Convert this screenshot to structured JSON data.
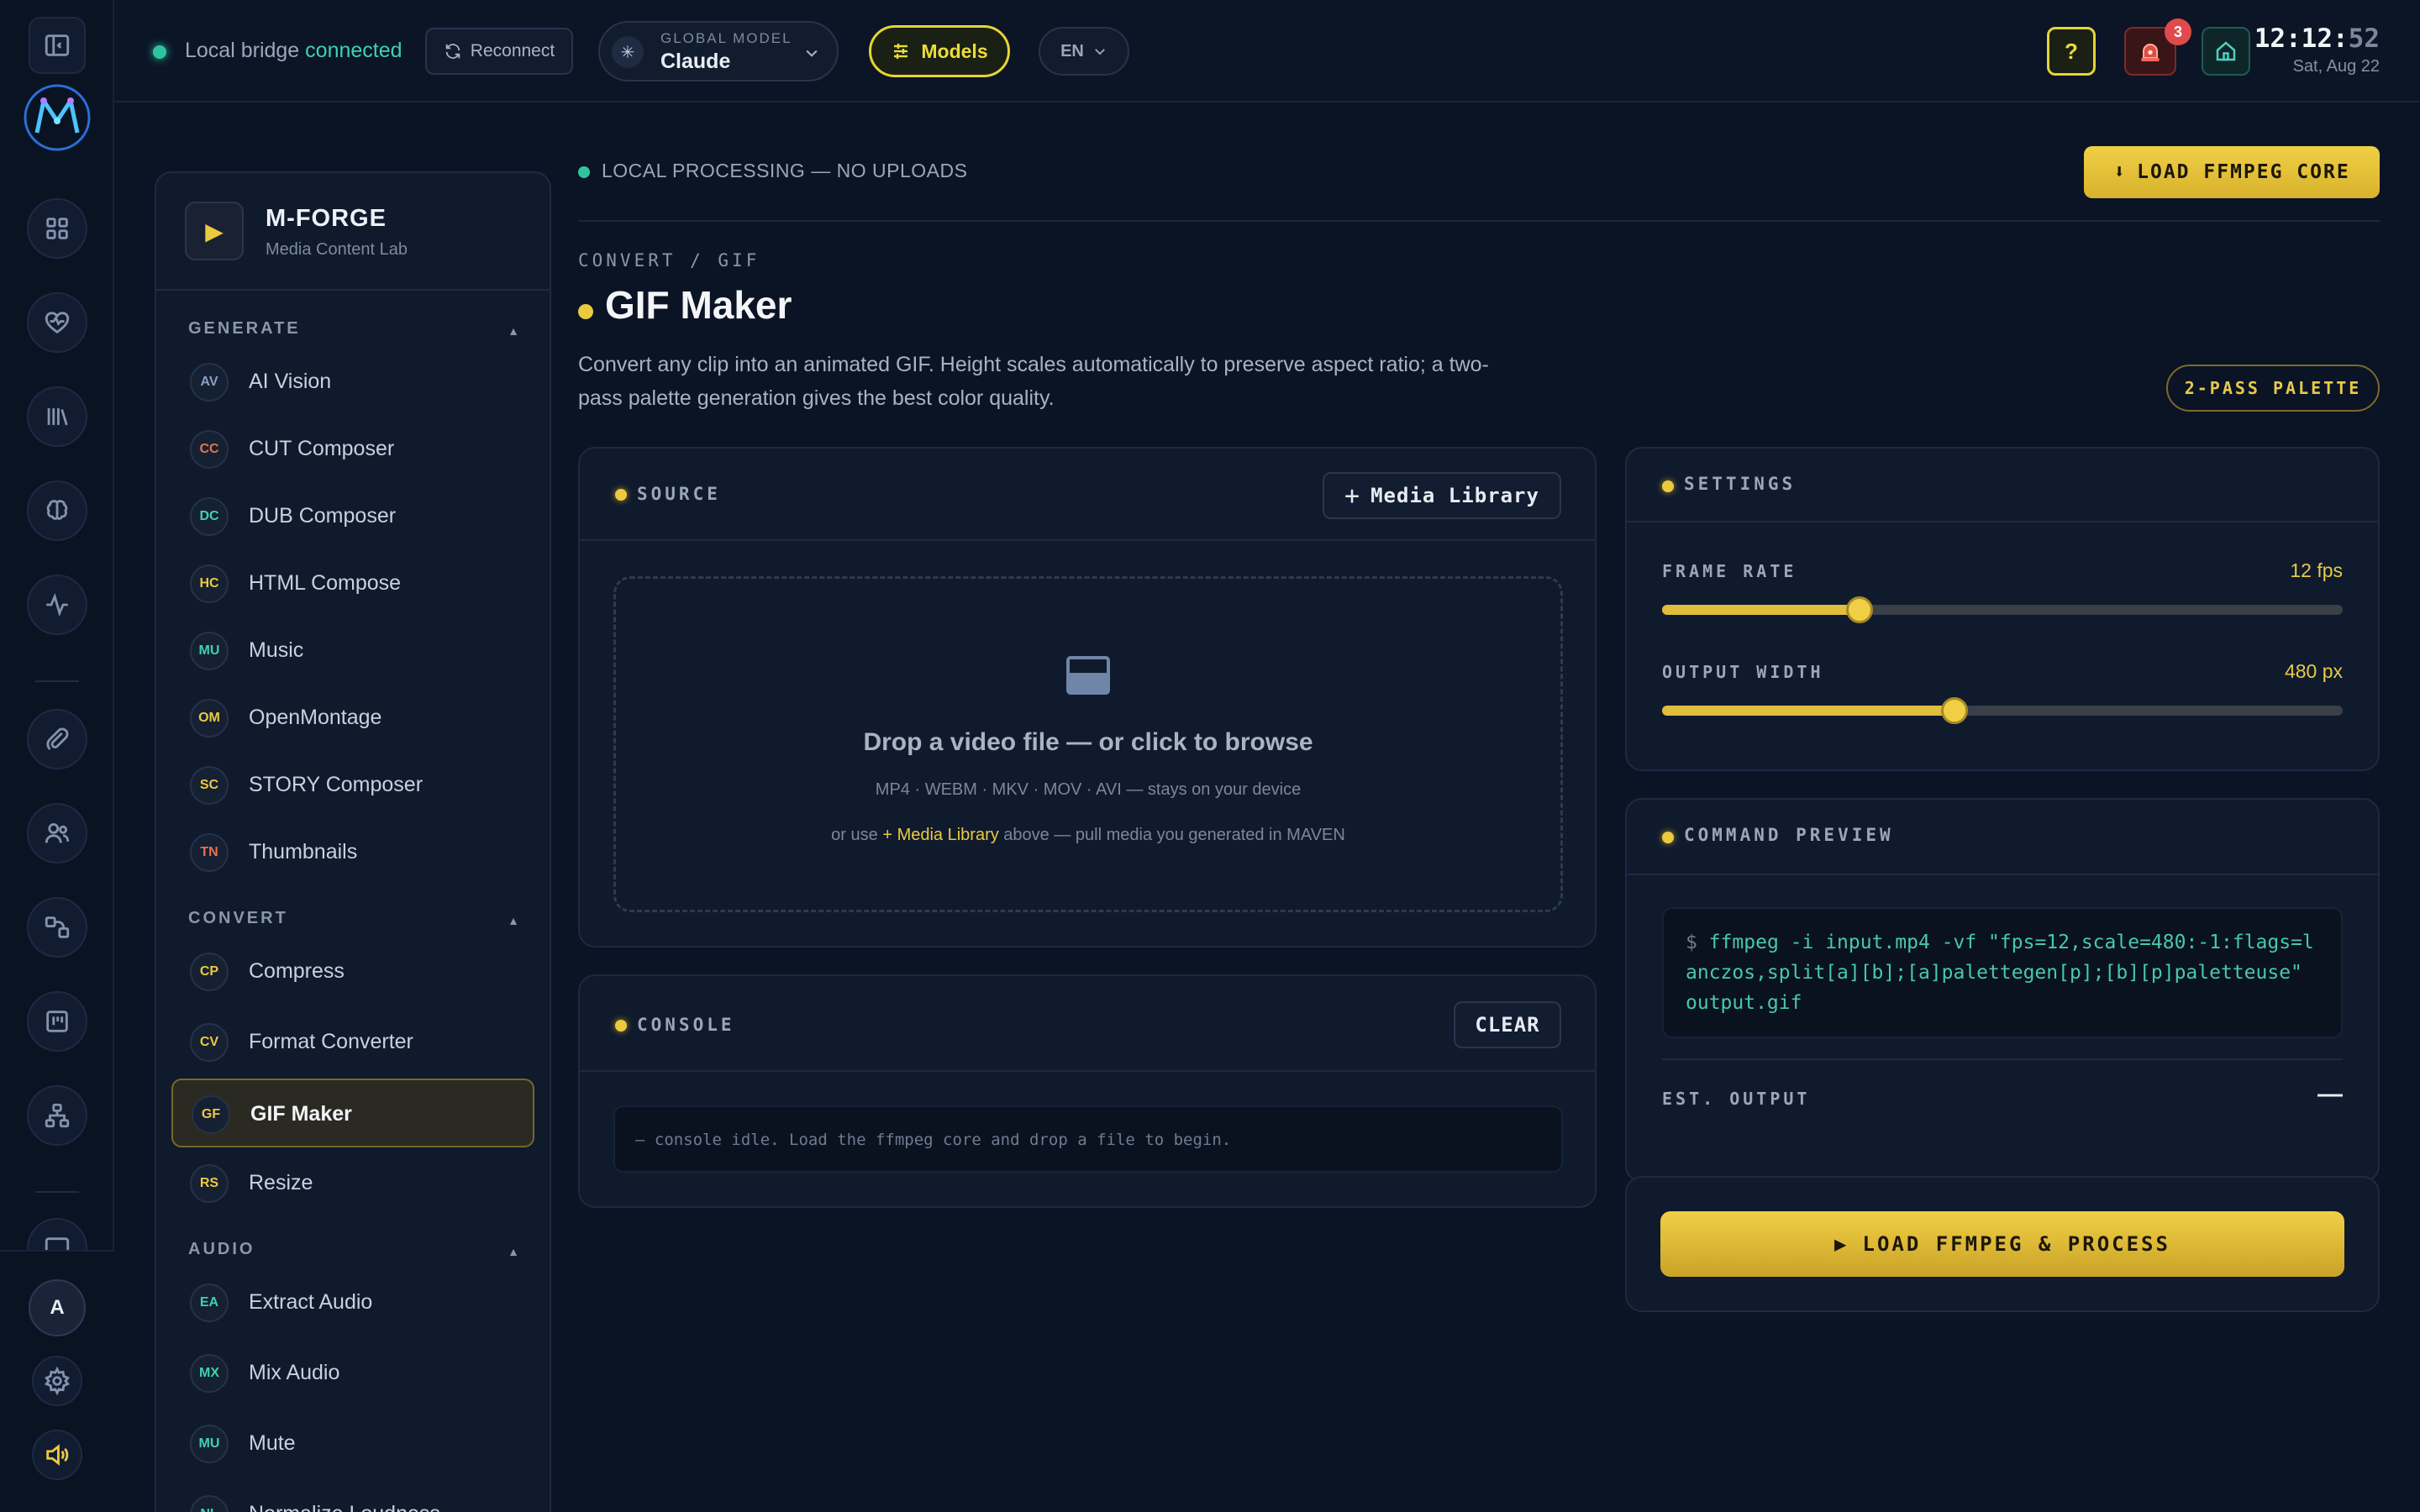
{
  "topbar": {
    "bridge_label": "Local bridge",
    "bridge_status": "connected",
    "reconnect_label": "Reconnect",
    "model_caption": "GLOBAL MODEL",
    "model_value": "Claude",
    "models_label": "Models",
    "lang_label": "EN",
    "help_label": "?",
    "alert_count": "3",
    "clock_hm": "12:12:",
    "clock_s": "52",
    "clock_date": "Sat, Aug 22"
  },
  "rail": {
    "avatar_initial": "A",
    "icons": [
      "panel-toggle-icon",
      "grid-icon",
      "heart-pulse-icon",
      "library-icon",
      "brain-icon",
      "activity-icon",
      "paperclip-icon",
      "users-icon",
      "workflow-icon",
      "kanban-icon",
      "sitemap-icon",
      "monitor-icon",
      "settings-icon",
      "speaker-icon"
    ]
  },
  "sidebar": {
    "title": "M-FORGE",
    "subtitle": "Media Content Lab",
    "sections": {
      "generate": "GENERATE",
      "convert": "CONVERT",
      "audio": "AUDIO"
    },
    "generate_items": [
      {
        "badge": "AV",
        "label": "AI Vision",
        "color": "#8aa0c0"
      },
      {
        "badge": "CC",
        "label": "CUT Composer",
        "color": "#e8734a"
      },
      {
        "badge": "DC",
        "label": "DUB Composer",
        "color": "#3fd1ac"
      },
      {
        "badge": "HC",
        "label": "HTML Compose",
        "color": "#ecca3f"
      },
      {
        "badge": "MU",
        "label": "Music",
        "color": "#3fd1ac"
      },
      {
        "badge": "OM",
        "label": "OpenMontage",
        "color": "#ecca3f"
      },
      {
        "badge": "SC",
        "label": "STORY Composer",
        "color": "#ecca3f"
      },
      {
        "badge": "TN",
        "label": "Thumbnails",
        "color": "#e8734a"
      }
    ],
    "convert_items": [
      {
        "badge": "CP",
        "label": "Compress",
        "color": "#ecca3f"
      },
      {
        "badge": "CV",
        "label": "Format Converter",
        "color": "#ecca3f"
      },
      {
        "badge": "GF",
        "label": "GIF Maker",
        "color": "#ecca3f"
      },
      {
        "badge": "RS",
        "label": "Resize",
        "color": "#ecca3f"
      }
    ],
    "audio_items": [
      {
        "badge": "EA",
        "label": "Extract Audio",
        "color": "#3fd1ac"
      },
      {
        "badge": "MX",
        "label": "Mix Audio",
        "color": "#3fd1ac"
      },
      {
        "badge": "MU",
        "label": "Mute",
        "color": "#3fd1ac"
      },
      {
        "badge": "NL",
        "label": "Normalize Loudness",
        "color": "#3fd1ac"
      }
    ]
  },
  "main": {
    "processing_note": "LOCAL PROCESSING — NO UPLOADS",
    "load_core_label": "LOAD FFMPEG CORE",
    "breadcrumb": "CONVERT / GIF",
    "title": "GIF Maker",
    "description": "Convert any clip into an animated GIF. Height scales automatically to preserve aspect ratio; a two-pass palette generation gives the best color quality.",
    "pill_label": "2-PASS PALETTE",
    "source": {
      "title": "SOURCE",
      "library_button": "Media Library",
      "drop_main": "Drop a video file — or click to browse",
      "drop_formats": "MP4 · WEBM · MKV · MOV · AVI — stays on your device",
      "drop_or_use": "or use",
      "drop_link": "+ Media Library",
      "drop_rest": "above — pull media you generated in MAVEN"
    },
    "console": {
      "title": "CONSOLE",
      "clear_label": "CLEAR",
      "idle_text": "— console idle. Load the ffmpeg core and drop a file to begin."
    },
    "settings": {
      "title": "SETTINGS",
      "frame_rate_label": "FRAME RATE",
      "frame_rate_value": "12 fps",
      "frame_rate_fraction": 0.29,
      "width_label": "OUTPUT WIDTH",
      "width_value": "480 px",
      "width_fraction": 0.43
    },
    "command": {
      "title": "COMMAND PREVIEW",
      "prompt": "$",
      "text": "ffmpeg -i input.mp4 -vf \"fps=12,scale=480:-1:flags=lanczos,split[a][b];[a]palettegen[p];[b][p]paletteuse\" output.gif",
      "est_label": "EST. OUTPUT",
      "est_value": "—"
    },
    "process_label": "LOAD FFMPEG & PROCESS"
  },
  "colors": {
    "accent": "#ecca3f",
    "ok": "#3fd1ac",
    "alert": "#e04a4a"
  }
}
